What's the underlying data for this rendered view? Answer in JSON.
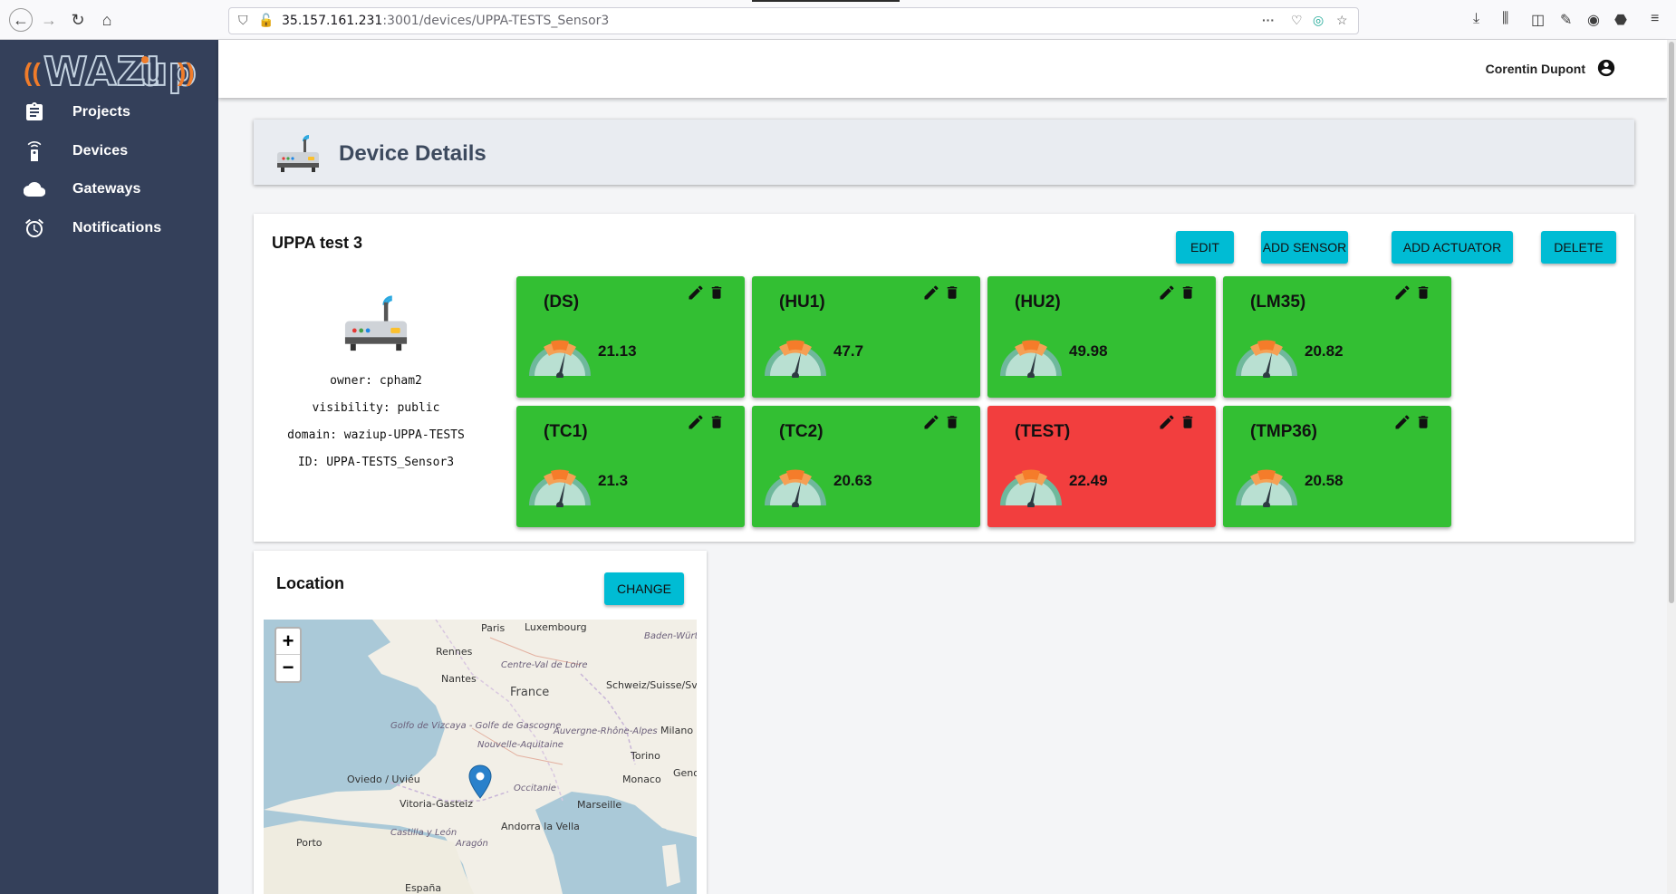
{
  "browser": {
    "url_host": "35.157.161.231",
    "url_path": ":3001/devices/UPPA-TESTS_Sensor3"
  },
  "sidebar": {
    "items": [
      {
        "label": "Projects",
        "icon": "clipboard-icon"
      },
      {
        "label": "Devices",
        "icon": "remote-icon"
      },
      {
        "label": "Gateways",
        "icon": "cloud-icon"
      },
      {
        "label": "Notifications",
        "icon": "alarm-clock-icon"
      }
    ]
  },
  "topbar": {
    "user": "Corentin Dupont"
  },
  "header": {
    "title": "Device Details"
  },
  "device": {
    "name": "UPPA test 3",
    "buttons": {
      "edit": "EDIT",
      "add_sensor": "ADD SENSOR",
      "add_actuator": "ADD ACTUATOR",
      "delete": "DELETE"
    },
    "info": {
      "owner": "owner: cpham2",
      "visibility": "visibility: public",
      "domain": "domain: waziup-UPPA-TESTS",
      "id": "ID: UPPA-TESTS_Sensor3"
    },
    "sensors": [
      {
        "name": "(DS)",
        "value": "21.13",
        "color": "#33bf33"
      },
      {
        "name": "(HU1)",
        "value": "47.7",
        "color": "#33bf33"
      },
      {
        "name": "(HU2)",
        "value": "49.98",
        "color": "#33bf33"
      },
      {
        "name": "(LM35)",
        "value": "20.82",
        "color": "#33bf33"
      },
      {
        "name": "(TC1)",
        "value": "21.3",
        "color": "#33bf33"
      },
      {
        "name": "(TC2)",
        "value": "20.63",
        "color": "#33bf33"
      },
      {
        "name": "(TEST)",
        "value": "22.49",
        "color": "#f23e3e"
      },
      {
        "name": "(TMP36)",
        "value": "20.58",
        "color": "#33bf33"
      }
    ]
  },
  "location": {
    "title": "Location",
    "change_label": "CHANGE",
    "zoom_in": "+",
    "zoom_out": "−",
    "map_labels": [
      "Paris",
      "Luxembourg",
      "Rennes",
      "Nantes",
      "France",
      "Centre-Val de Loire",
      "Schweiz/Suisse/Svizzera",
      "Golfo de Vizcaya - Golfe de Gascogne",
      "Nouvelle-Aquitaine",
      "Auvergne-Rhône-Alpes",
      "Milano",
      "Torino",
      "Oviedo / Uviéu",
      "Vitoria-Gasteiz",
      "Occitanie",
      "Monaco",
      "Marseille",
      "Andorra la Vella",
      "Porto",
      "Castilla y León",
      "Aragón",
      "España",
      "Baden-Württemberg",
      "Genova"
    ]
  }
}
